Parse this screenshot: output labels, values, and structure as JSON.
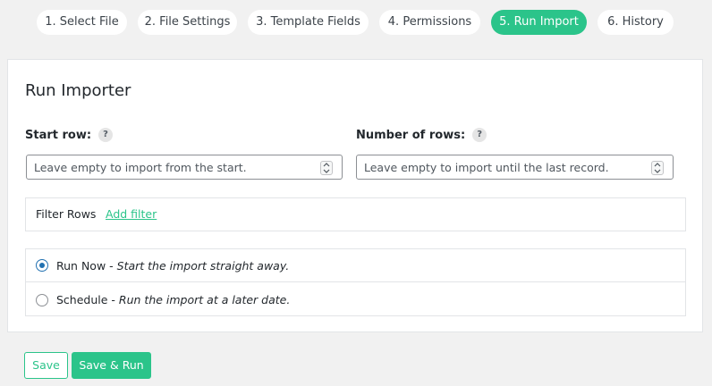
{
  "steps": [
    {
      "label": "1. Select File",
      "active": false
    },
    {
      "label": "2. File Settings",
      "active": false
    },
    {
      "label": "3. Template Fields",
      "active": false
    },
    {
      "label": "4. Permissions",
      "active": false
    },
    {
      "label": "5. Run Import",
      "active": true
    },
    {
      "label": "6. History",
      "active": false
    }
  ],
  "card": {
    "title": "Run Importer",
    "start_row": {
      "label": "Start row:",
      "help": "?",
      "value": "",
      "placeholder": "Leave empty to import from the start."
    },
    "number_of_rows": {
      "label": "Number of rows:",
      "help": "?",
      "value": "",
      "placeholder": "Leave empty to import until the last record."
    },
    "filter": {
      "label": "Filter Rows",
      "link": "Add filter"
    },
    "run_options": [
      {
        "name": "Run Now",
        "separator": " - ",
        "description": "Start the import straight away.",
        "checked": true
      },
      {
        "name": "Schedule",
        "separator": " - ",
        "description": "Run the import at a later date.",
        "checked": false
      }
    ]
  },
  "buttons": {
    "save": "Save",
    "save_run": "Save & Run"
  },
  "colors": {
    "accent": "#2bc48a",
    "radio_checked": "#2271b1",
    "background": "#f1f1f1"
  }
}
